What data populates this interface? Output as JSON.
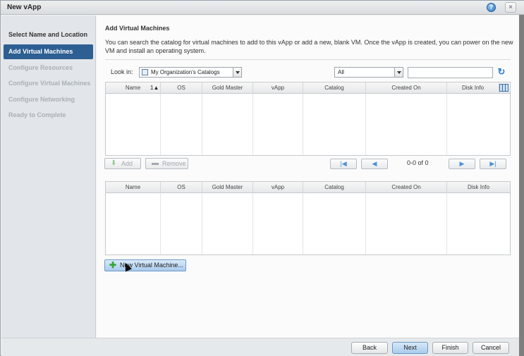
{
  "window": {
    "title": "New vApp"
  },
  "sidebar": {
    "items": [
      {
        "label": "Select Name and Location",
        "state": "done"
      },
      {
        "label": "Add Virtual Machines",
        "state": "active"
      },
      {
        "label": "Configure Resources",
        "state": "disabled"
      },
      {
        "label": "Configure Virtual Machines",
        "state": "disabled"
      },
      {
        "label": "Configure Networking",
        "state": "disabled"
      },
      {
        "label": "Ready to Complete",
        "state": "disabled"
      }
    ]
  },
  "main": {
    "heading": "Add Virtual Machines",
    "description": "You can search the catalog for virtual machines to add to this vApp or add a new, blank VM. Once the vApp is created, you can power on the new VM and install an operating system.",
    "look_in_label": "Look in:",
    "catalog_select_value": "My Organization's Catalogs",
    "filter_select_value": "All",
    "search_value": "",
    "catalog_table": {
      "columns": [
        "Name",
        "OS",
        "Gold Master",
        "vApp",
        "Catalog",
        "Created On",
        "Disk Info"
      ],
      "sort_indicator": "1▲",
      "rows": []
    },
    "add_button": "Add",
    "remove_button": "Remove",
    "pager_text": "0-0 of 0",
    "selected_table": {
      "columns": [
        "Name",
        "OS",
        "Gold Master",
        "vApp",
        "Catalog",
        "Created On",
        "Disk Info"
      ],
      "rows": []
    },
    "new_vm_button": "New Virtual Machine..."
  },
  "footer": {
    "back": "Back",
    "next": "Next",
    "finish": "Finish",
    "cancel": "Cancel"
  },
  "colors": {
    "active_nav": "#2d5f92",
    "refresh_icon": "#2a7bd1",
    "add_icon": "#3aa53a"
  }
}
